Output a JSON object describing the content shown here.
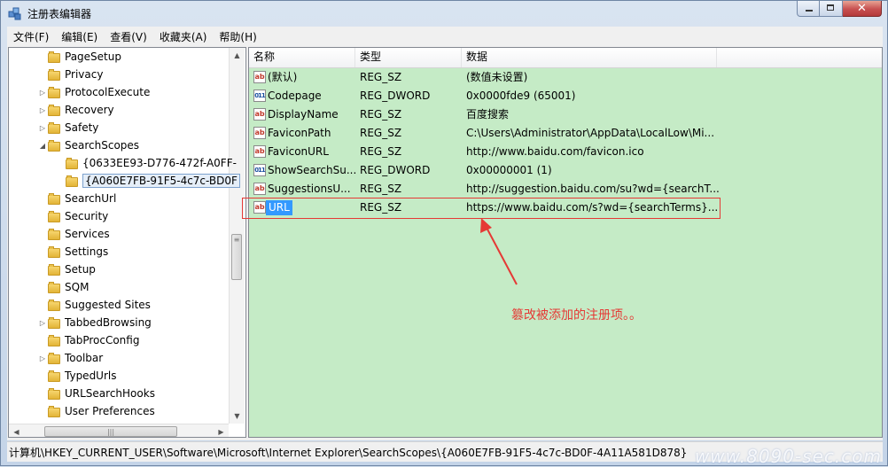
{
  "window": {
    "title": "注册表编辑器"
  },
  "menu": [
    "文件(F)",
    "编辑(E)",
    "查看(V)",
    "收藏夹(A)",
    "帮助(H)"
  ],
  "tree": [
    {
      "label": "PageSetup",
      "indent": 1,
      "expander": ""
    },
    {
      "label": "Privacy",
      "indent": 1,
      "expander": ""
    },
    {
      "label": "ProtocolExecute",
      "indent": 1,
      "expander": "▷"
    },
    {
      "label": "Recovery",
      "indent": 1,
      "expander": "▷"
    },
    {
      "label": "Safety",
      "indent": 1,
      "expander": "▷"
    },
    {
      "label": "SearchScopes",
      "indent": 1,
      "expander": "◢"
    },
    {
      "label": "{0633EE93-D776-472f-A0FF-",
      "indent": 2,
      "expander": ""
    },
    {
      "label": "{A060E7FB-91F5-4c7c-BD0F",
      "indent": 2,
      "expander": "",
      "selected": true
    },
    {
      "label": "SearchUrl",
      "indent": 1,
      "expander": ""
    },
    {
      "label": "Security",
      "indent": 1,
      "expander": ""
    },
    {
      "label": "Services",
      "indent": 1,
      "expander": ""
    },
    {
      "label": "Settings",
      "indent": 1,
      "expander": ""
    },
    {
      "label": "Setup",
      "indent": 1,
      "expander": ""
    },
    {
      "label": "SQM",
      "indent": 1,
      "expander": ""
    },
    {
      "label": "Suggested Sites",
      "indent": 1,
      "expander": ""
    },
    {
      "label": "TabbedBrowsing",
      "indent": 1,
      "expander": "▷"
    },
    {
      "label": "TabProcConfig",
      "indent": 1,
      "expander": ""
    },
    {
      "label": "Toolbar",
      "indent": 1,
      "expander": "▷"
    },
    {
      "label": "TypedUrls",
      "indent": 1,
      "expander": ""
    },
    {
      "label": "URLSearchHooks",
      "indent": 1,
      "expander": ""
    },
    {
      "label": "User Preferences",
      "indent": 1,
      "expander": ""
    }
  ],
  "list": {
    "columns": [
      "名称",
      "类型",
      "数据"
    ],
    "rows": [
      {
        "icon": "string-value-icon",
        "glyph": "ab",
        "name": "(默认)",
        "type": "REG_SZ",
        "data": "(数值未设置)"
      },
      {
        "icon": "dword-value-icon",
        "glyph": "011",
        "name": "Codepage",
        "type": "REG_DWORD",
        "data": "0x0000fde9 (65001)"
      },
      {
        "icon": "string-value-icon",
        "glyph": "ab",
        "name": "DisplayName",
        "type": "REG_SZ",
        "data": "百度搜索"
      },
      {
        "icon": "string-value-icon",
        "glyph": "ab",
        "name": "FaviconPath",
        "type": "REG_SZ",
        "data": "C:\\Users\\Administrator\\AppData\\LocalLow\\Mi..."
      },
      {
        "icon": "string-value-icon",
        "glyph": "ab",
        "name": "FaviconURL",
        "type": "REG_SZ",
        "data": "http://www.baidu.com/favicon.ico"
      },
      {
        "icon": "dword-value-icon",
        "glyph": "011",
        "name": "ShowSearchSu...",
        "type": "REG_DWORD",
        "data": "0x00000001 (1)"
      },
      {
        "icon": "string-value-icon",
        "glyph": "ab",
        "name": "SuggestionsU...",
        "type": "REG_SZ",
        "data": "http://suggestion.baidu.com/su?wd={searchT..."
      },
      {
        "icon": "string-value-icon",
        "glyph": "ab",
        "name": "URL",
        "type": "REG_SZ",
        "data": "https://www.baidu.com/s?wd={searchTerms}...",
        "selected": true
      }
    ]
  },
  "annotation": "篡改被添加的注册项。。",
  "status": "计算机\\HKEY_CURRENT_USER\\Software\\Microsoft\\Internet Explorer\\SearchScopes\\{A060E7FB-91F5-4c7c-BD0F-4A11A581D878}",
  "watermark": "www.8090-sec.com",
  "colors": {
    "list_bg": "#c5ebc6",
    "selection": "#3399ff",
    "annotation": "#e53935"
  }
}
